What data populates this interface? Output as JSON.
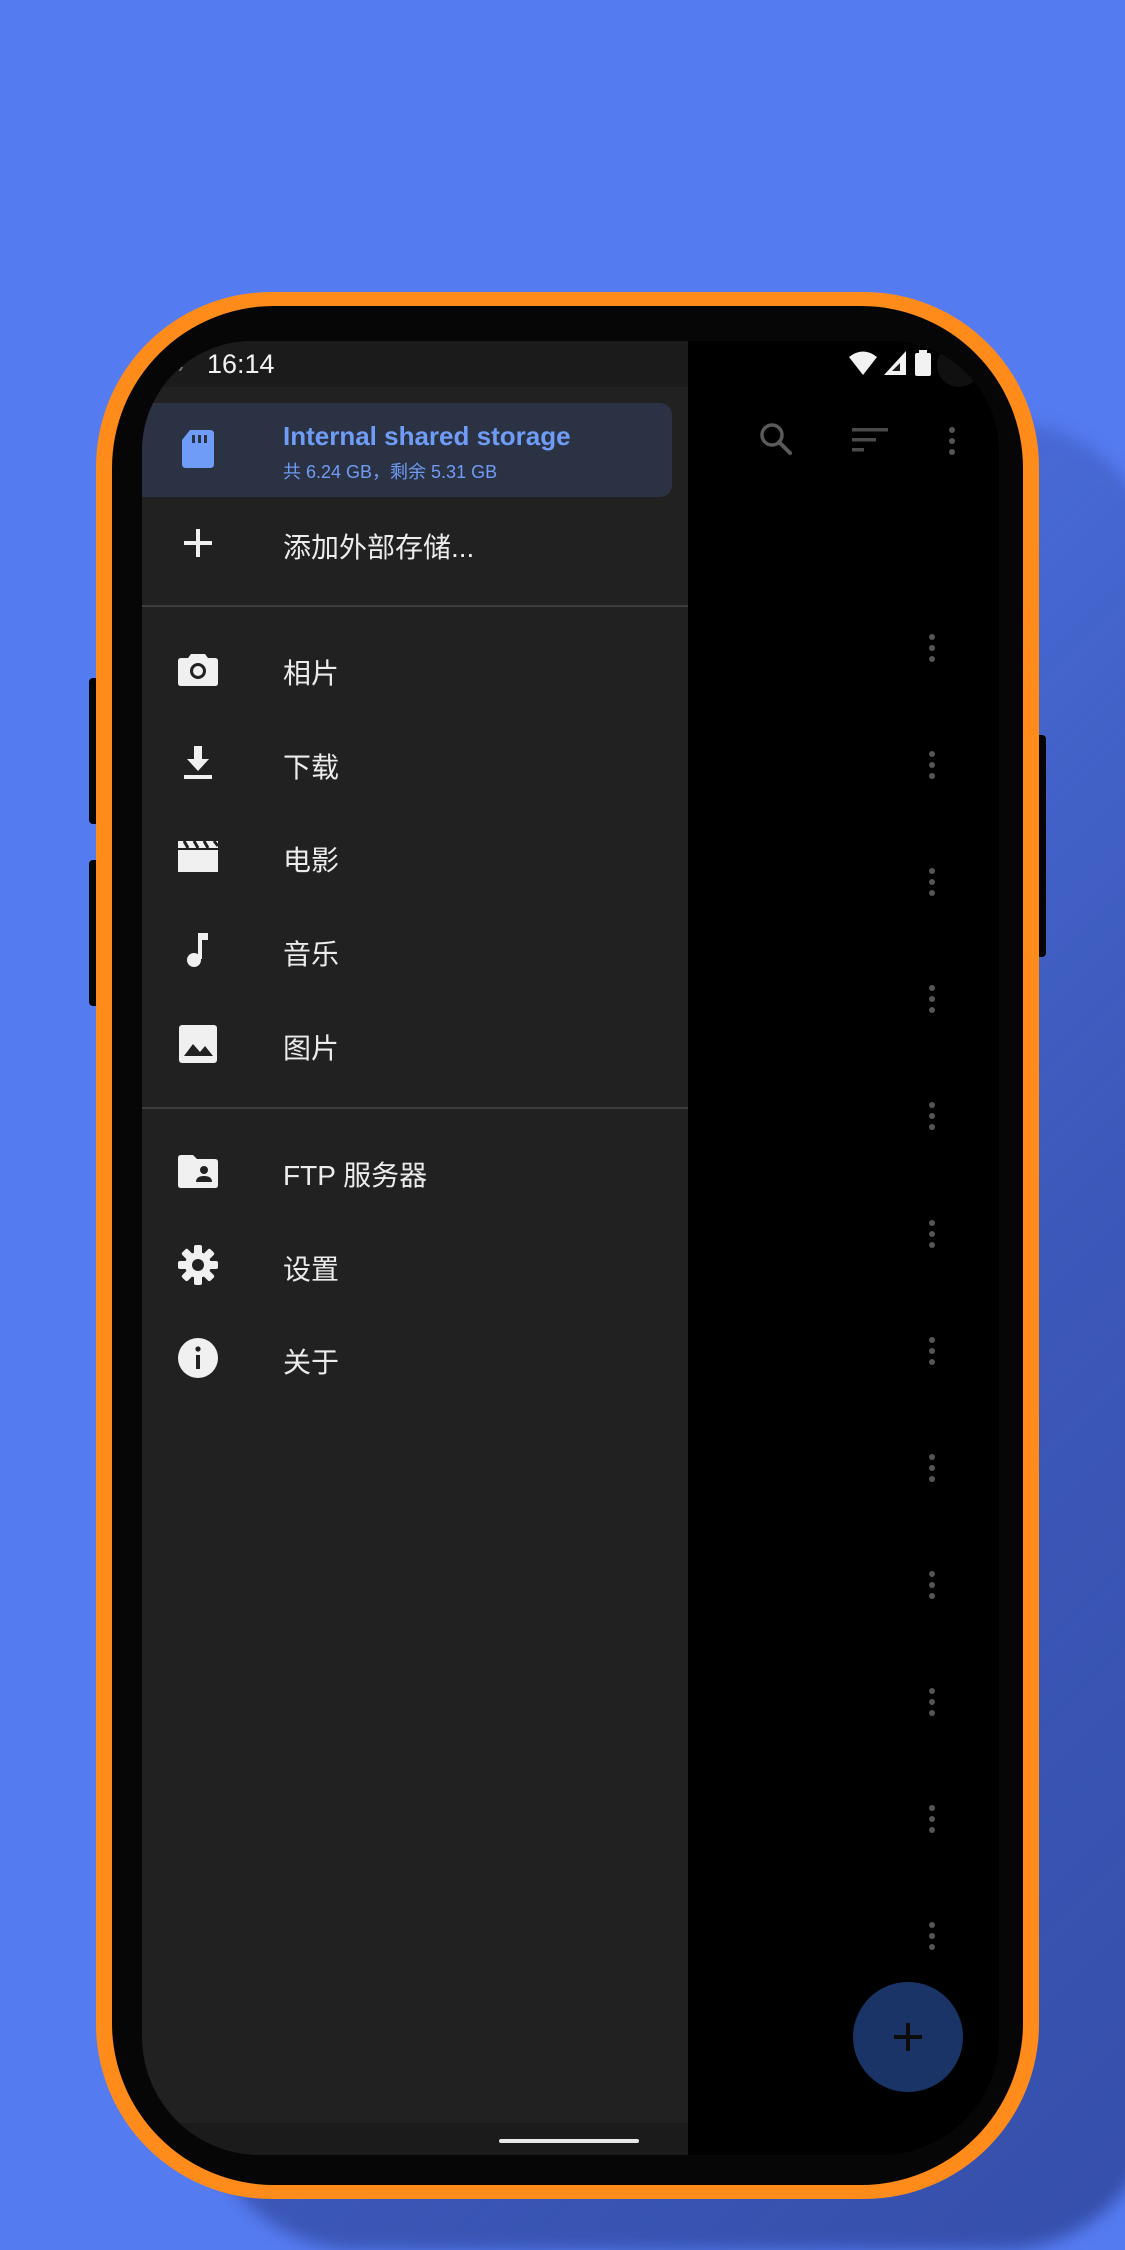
{
  "status_bar": {
    "time": "16:14"
  },
  "drawer": {
    "storage": {
      "title": "Internal shared storage",
      "subtitle": "共 6.24 GB，剩余 5.31 GB",
      "icon": "sd-card-icon"
    },
    "add_storage": {
      "label": "添加外部存储...",
      "icon": "plus-icon"
    },
    "bookmarks": [
      {
        "label": "相片",
        "icon": "camera-icon"
      },
      {
        "label": "下载",
        "icon": "download-icon"
      },
      {
        "label": "电影",
        "icon": "movie-icon"
      },
      {
        "label": "音乐",
        "icon": "music-icon"
      },
      {
        "label": "图片",
        "icon": "image-icon"
      }
    ],
    "tools": [
      {
        "label": "FTP 服务器",
        "icon": "ftp-folder-icon"
      },
      {
        "label": "设置",
        "icon": "gear-icon"
      },
      {
        "label": "关于",
        "icon": "info-icon"
      }
    ]
  },
  "colors": {
    "background": "#557bf1",
    "phone_frame": "#ff8c1a",
    "drawer": "#212121",
    "accent": "#6f9cf6",
    "fab": "#1b3468"
  }
}
